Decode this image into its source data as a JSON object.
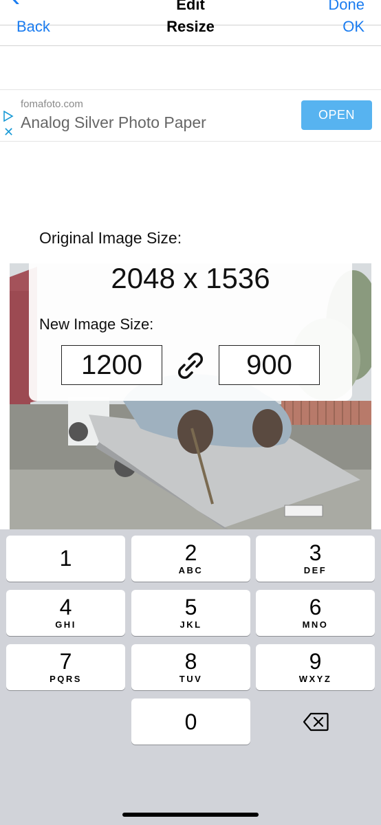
{
  "nav": {
    "title": "Edit",
    "done_label": "Done",
    "sub_back_label": "Back",
    "sub_title": "Resize",
    "sub_ok_label": "OK"
  },
  "ad": {
    "domain": "fomafoto.com",
    "headline": "Analog Silver Photo Paper",
    "open_label": "OPEN"
  },
  "resize": {
    "original_label": "Original Image Size:",
    "original_size": "2048 x 1536",
    "new_label": "New Image Size:",
    "width_value": "1200",
    "height_value": "900"
  },
  "keyboard": {
    "keys": [
      {
        "num": "1",
        "letters": ""
      },
      {
        "num": "2",
        "letters": "ABC"
      },
      {
        "num": "3",
        "letters": "DEF"
      },
      {
        "num": "4",
        "letters": "GHI"
      },
      {
        "num": "5",
        "letters": "JKL"
      },
      {
        "num": "6",
        "letters": "MNO"
      },
      {
        "num": "7",
        "letters": "PQRS"
      },
      {
        "num": "8",
        "letters": "TUV"
      },
      {
        "num": "9",
        "letters": "WXYZ"
      },
      {
        "num": "0",
        "letters": ""
      }
    ],
    "delete_icon": "backspace-icon"
  },
  "colors": {
    "accent": "#1a7cf0",
    "ad_button": "#57b3f0",
    "keyboard_bg": "#d1d3d9"
  }
}
